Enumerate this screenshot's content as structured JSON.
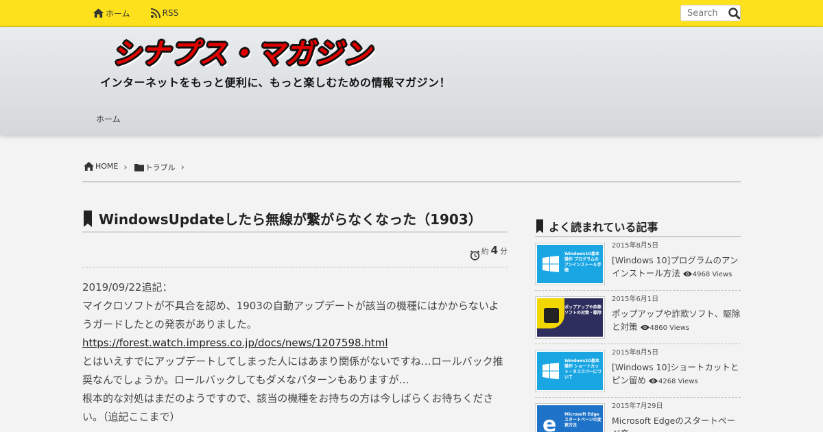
{
  "topnav": {
    "home": "ホーム",
    "rss": "RSS",
    "search_placeholder": "Search"
  },
  "header": {
    "logo_text": "シナプス・マガジン",
    "tagline": "インターネットをもっと便利に、もっと楽しむための情報マガジン！",
    "nav_home": "ホーム"
  },
  "breadcrumb": {
    "home": "HOME",
    "category": "トラブル"
  },
  "article": {
    "title": "WindowsUpdateしたら無線が繋がらなくなった（1903）",
    "readtime_prefix": "約",
    "readtime_value": "4",
    "readtime_unit": "分",
    "p1": "2019/09/22追記：",
    "p2": "マイクロソフトが不具合を認め、1903の自動アップデートが該当の機種にはかからないようガードしたとの発表がありました。",
    "link": "https://forest.watch.impress.co.jp/docs/news/1207598.html",
    "p3": "とはいえすでにアップデートしてしまった人にはあまり関係がないですね…ロールバック推奨なんでしょうか。ロールバックしてもダメなパターンもありますが…",
    "p4": "根本的な対処はまだのようですので、該当の機種をお持ちの方は今しばらくお待ちください。（追記ここまで）"
  },
  "sidebar": {
    "title": "よく読まれている記事",
    "items": [
      {
        "date": "2015年8月5日",
        "title": "[Windows 10]プログラムのアンインストール方法",
        "views": "4968 Views",
        "thumb_text": "Windows10基本操作 プログラムのアンインストール手順"
      },
      {
        "date": "2015年6月1日",
        "title": "ポップアップや詐欺ソフト、駆除と対策",
        "views": "4860 Views",
        "thumb_text": "ポップアップや詐欺ソフトの対策・駆除"
      },
      {
        "date": "2015年8月5日",
        "title": "[Windows 10]ショートカットとピン留め",
        "views": "4268 Views",
        "thumb_text": "Windows10基本操作 ショートカット・タスクバーについて"
      },
      {
        "date": "2015年7月29日",
        "title": "Microsoft Edgeのスタートページ変",
        "views": "",
        "thumb_text": "Microsoft Edge スタートページの変更方法"
      }
    ]
  },
  "colors": {
    "topbar": "#fde11c",
    "logo_red": "#e00000",
    "windows_blue": "#1aa6e3"
  },
  "icons": [
    "home-icon",
    "rss-icon",
    "search-icon",
    "folder-icon",
    "bookmark-icon",
    "alarm-clock-icon",
    "eye-icon",
    "windows-logo-icon",
    "edge-logo-icon"
  ]
}
